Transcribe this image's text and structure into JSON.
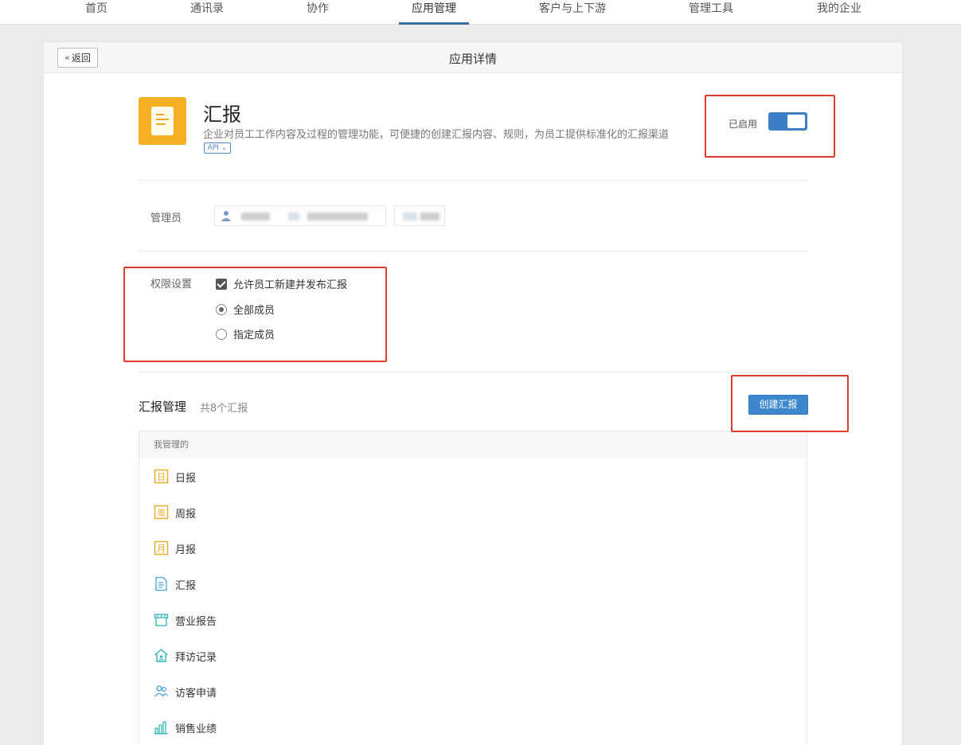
{
  "nav": {
    "items": [
      "首页",
      "通讯录",
      "协作",
      "应用管理",
      "客户与上下游",
      "管理工具",
      "我的企业"
    ],
    "active_index": 3
  },
  "header": {
    "back_label": "返回",
    "title": "应用详情"
  },
  "app": {
    "name": "汇报",
    "description": "企业对员工工作内容及过程的管理功能，可便捷的创建汇报内容、规则，为员工提供标准化的汇报渠道",
    "api_tag": "API",
    "status_label": "已启用",
    "enabled": true,
    "icon_color": "#f5b023"
  },
  "admin": {
    "label": "管理员"
  },
  "permissions": {
    "label": "权限设置",
    "allow_create_label": "允许员工新建并发布汇报",
    "allow_create_checked": true,
    "options": [
      {
        "label": "全部成员",
        "selected": true
      },
      {
        "label": "指定成员",
        "selected": false
      }
    ]
  },
  "reports": {
    "title": "汇报管理",
    "count_text": "共8个汇报",
    "create_label": "创建汇报",
    "group_label": "我管理的",
    "items": [
      {
        "label": "日报",
        "icon": "daily-report-icon"
      },
      {
        "label": "周报",
        "icon": "weekly-report-icon"
      },
      {
        "label": "月报",
        "icon": "monthly-report-icon"
      },
      {
        "label": "汇报",
        "icon": "report-document-icon"
      },
      {
        "label": "营业报告",
        "icon": "storefront-icon"
      },
      {
        "label": "拜访记录",
        "icon": "house-visit-icon"
      },
      {
        "label": "访客申请",
        "icon": "visitors-icon"
      },
      {
        "label": "销售业绩",
        "icon": "bar-chart-icon"
      }
    ]
  },
  "colors": {
    "accent": "#3d87cf",
    "highlight": "#e03b2e",
    "orange_icon": "#f0a821",
    "teal_icon": "#2bb5b0",
    "blue_icon": "#4a9fd9"
  }
}
